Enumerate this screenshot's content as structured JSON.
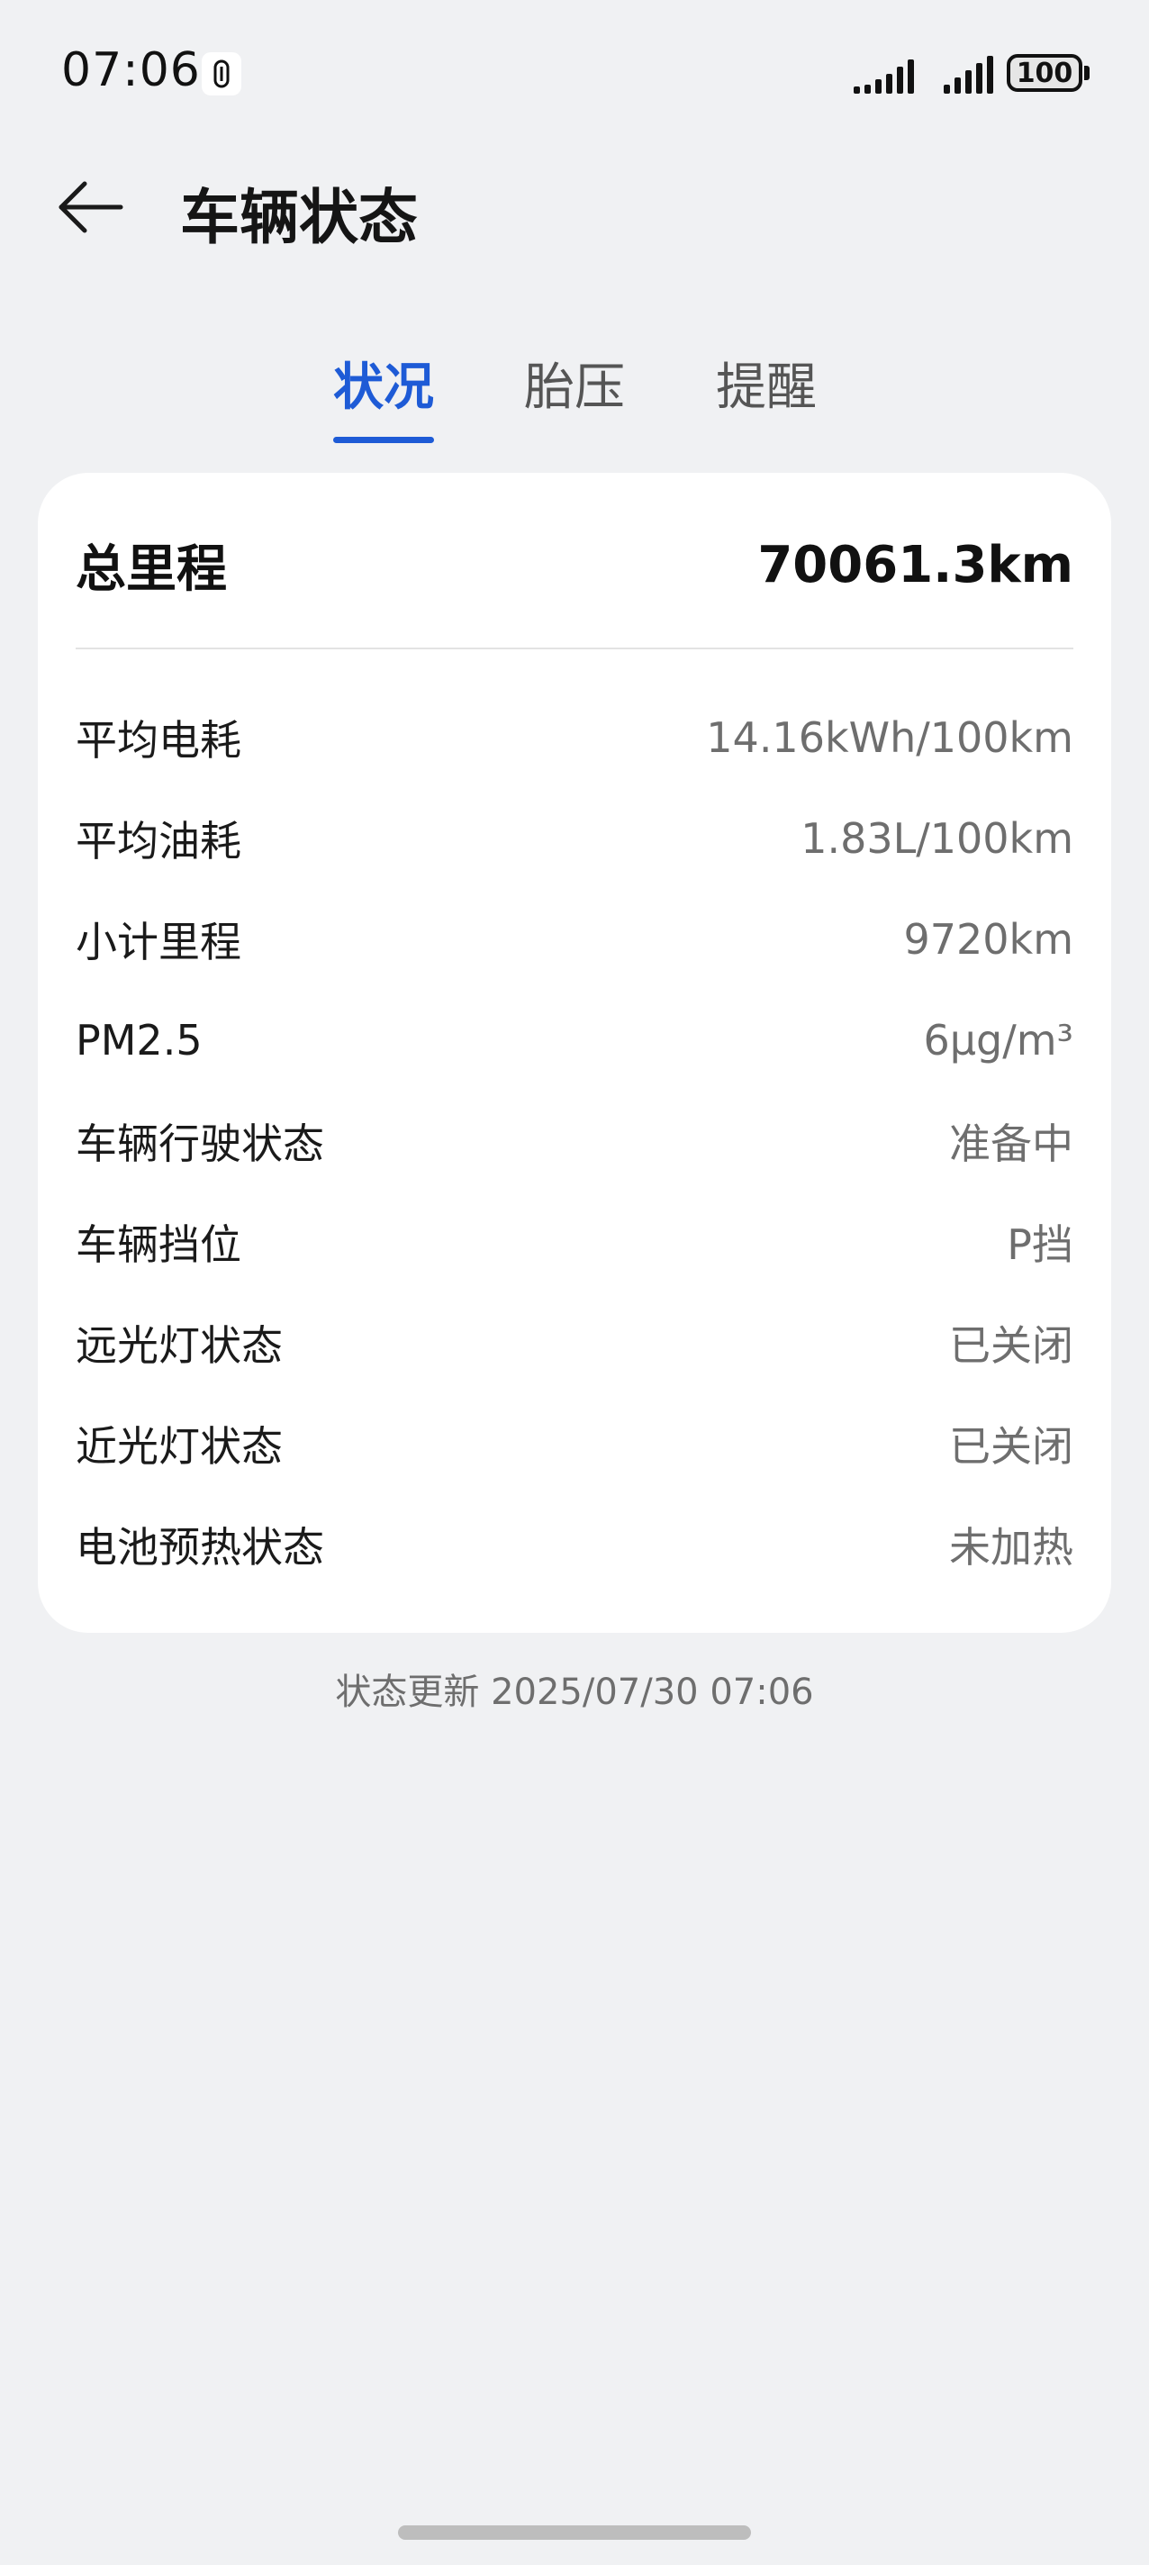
{
  "status_bar": {
    "time": "07:06",
    "battery": "100"
  },
  "header": {
    "title": "车辆状态",
    "back_icon": "arrow-left-icon"
  },
  "tabs": [
    {
      "label": "状况",
      "active": true
    },
    {
      "label": "胎压",
      "active": false
    },
    {
      "label": "提醒",
      "active": false
    }
  ],
  "card": {
    "total": {
      "label": "总里程",
      "value": "70061.3km"
    },
    "rows": [
      {
        "label": "平均电耗",
        "value": "14.16kWh/100km"
      },
      {
        "label": "平均油耗",
        "value": "1.83L/100km"
      },
      {
        "label": "小计里程",
        "value": "9720km"
      },
      {
        "label": "PM2.5",
        "value": "6μg/m³"
      },
      {
        "label": "车辆行驶状态",
        "value": "准备中"
      },
      {
        "label": "车辆挡位",
        "value": "P挡"
      },
      {
        "label": "远光灯状态",
        "value": "已关闭"
      },
      {
        "label": "近光灯状态",
        "value": "已关闭"
      },
      {
        "label": "电池预热状态",
        "value": "未加热"
      }
    ]
  },
  "footer": {
    "update_text": "状态更新 2025/07/30 07:06"
  },
  "colors": {
    "accent": "#1e5bd6",
    "background": "#f0f1f3",
    "card": "#ffffff",
    "secondary_text": "#6e6e6e"
  }
}
